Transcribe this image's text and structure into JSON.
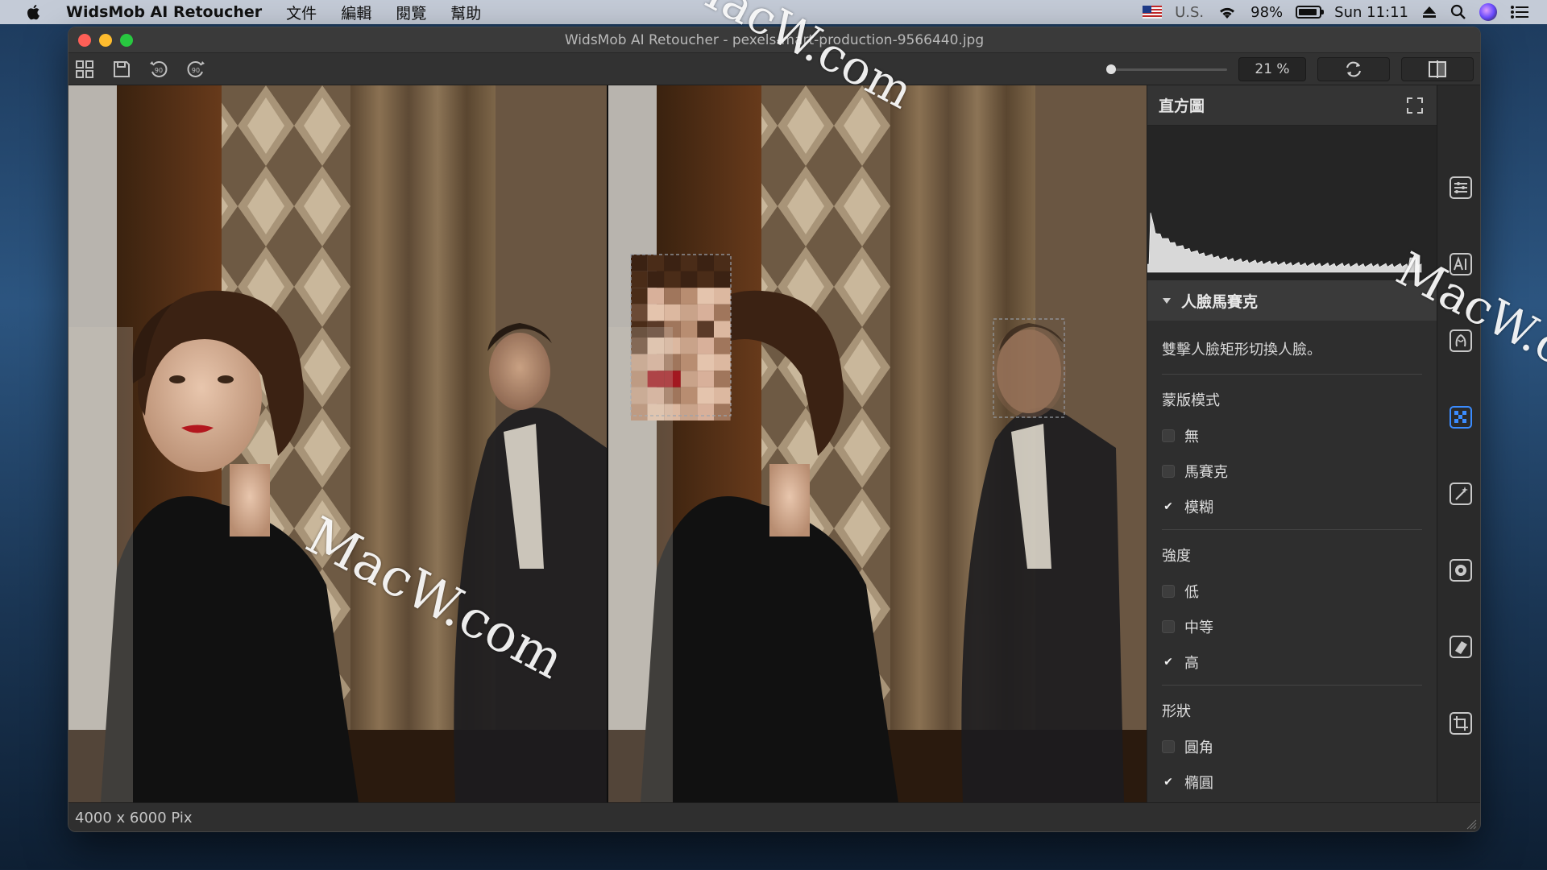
{
  "menubar": {
    "app_name": "WidsMob AI Retoucher",
    "menus": [
      "文件",
      "編輯",
      "閱覽",
      "幫助"
    ],
    "input_source": "U.S.",
    "battery": "98%",
    "clock": "Sun 11:11"
  },
  "window": {
    "title": "WidsMob AI Retoucher - pexels-mart-production-9566440.jpg"
  },
  "toolbar": {
    "zoom_value": "21 %",
    "zoom_level": 0.0
  },
  "status": {
    "dimensions": "4000 x 6000 Pix"
  },
  "panel": {
    "histogram_title": "直方圖",
    "section_title": "人臉馬賽克",
    "description": "雙擊人臉矩形切換人臉。",
    "groups": [
      {
        "title": "蒙版模式",
        "options": [
          {
            "label": "無",
            "checked": false
          },
          {
            "label": "馬賽克",
            "checked": false
          },
          {
            "label": "模糊",
            "checked": true
          }
        ]
      },
      {
        "title": "強度",
        "options": [
          {
            "label": "低",
            "checked": false
          },
          {
            "label": "中等",
            "checked": false
          },
          {
            "label": "高",
            "checked": true
          }
        ]
      },
      {
        "title": "形狀",
        "options": [
          {
            "label": "圓角",
            "checked": false
          },
          {
            "label": "橢圓",
            "checked": true
          }
        ]
      }
    ]
  },
  "rail_icons": [
    "adjust-sliders-icon",
    "ai-icon",
    "skin-icon",
    "face-mosaic-icon",
    "magic-wand-icon",
    "settings-icon",
    "eraser-icon",
    "crop-icon"
  ],
  "watermark": {
    "text": "MacW.com"
  },
  "colors": {
    "accent": "#3b8cff",
    "panel_bg": "#2e2e2e",
    "canvas_bg": "#1a1a1a"
  }
}
